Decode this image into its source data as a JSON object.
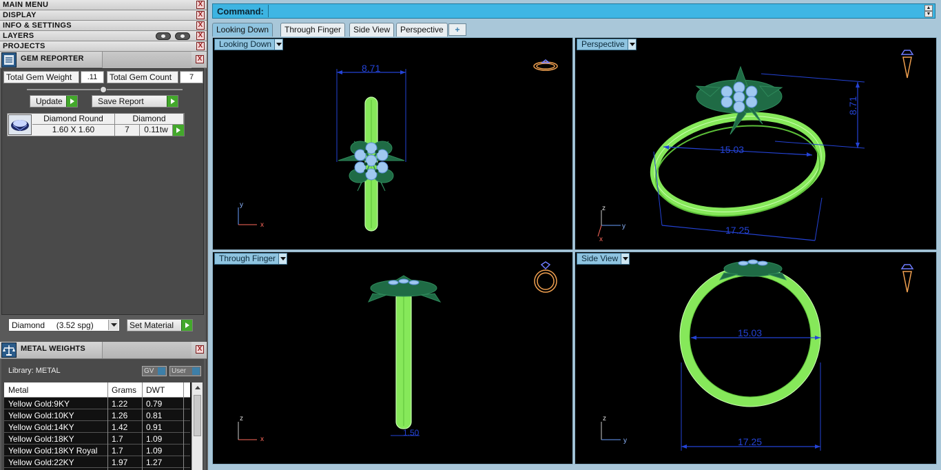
{
  "menu": {
    "items": [
      {
        "label": "MAIN MENU"
      },
      {
        "label": "DISPLAY"
      },
      {
        "label": "INFO & SETTINGS"
      },
      {
        "label": "LAYERS"
      },
      {
        "label": "PROJECTS"
      }
    ],
    "close_glyph": "X"
  },
  "gem_reporter": {
    "title": "GEM REPORTER",
    "total_weight_label": "Total Gem Weight",
    "total_weight_value": ".11",
    "total_count_label": "Total Gem Count",
    "total_count_value": "7",
    "update_label": "Update",
    "save_report_label": "Save Report",
    "gem": {
      "shape_header": "Diamond Round",
      "material_header": "Diamond",
      "size": "1.60 X 1.60",
      "count": "7",
      "weight": "0.11tw"
    },
    "material_select": "Diamond     (3.52 spg)",
    "set_material_label": "Set Material"
  },
  "metal_weights": {
    "title": "METAL WEIGHTS",
    "library_label": "Library: METAL",
    "gv_label": "GV",
    "user_label": "User",
    "columns": [
      "Metal",
      "Grams",
      "DWT"
    ],
    "rows": [
      [
        "Yellow Gold:9KY",
        "1.22",
        "0.79"
      ],
      [
        "Yellow Gold:10KY",
        "1.26",
        "0.81"
      ],
      [
        "Yellow Gold:14KY",
        "1.42",
        "0.91"
      ],
      [
        "Yellow Gold:18KY",
        "1.7",
        "1.09"
      ],
      [
        "Yellow Gold:18KY Royal",
        "1.7",
        "1.09"
      ],
      [
        "Yellow Gold:22KY",
        "1.97",
        "1.27"
      ]
    ]
  },
  "command": {
    "label": "Command:",
    "value": ""
  },
  "tabs": [
    {
      "label": "Looking Down",
      "active": true
    },
    {
      "label": "Through Finger",
      "active": false
    },
    {
      "label": "Side View",
      "active": false
    },
    {
      "label": "Perspective",
      "active": false
    }
  ],
  "viewports": {
    "top_left": {
      "label": "Looking Down",
      "dims": [
        "8.71"
      ],
      "axes": [
        "y",
        "x"
      ]
    },
    "top_right": {
      "label": "Perspective",
      "dims": [
        "15.03",
        "8.71",
        "17.25"
      ],
      "axes": [
        "z",
        "y",
        "x"
      ]
    },
    "bottom_left": {
      "label": "Through Finger",
      "dims": [
        "1.50"
      ],
      "axes": [
        "z",
        "x"
      ]
    },
    "bottom_right": {
      "label": "Side View",
      "dims": [
        "15.03",
        "17.25"
      ],
      "axes": [
        "z",
        "y"
      ]
    }
  },
  "colors": {
    "ring_green": "#8ef060",
    "leaf_green": "#1f6b45",
    "gem_blue": "#9fc8f0",
    "dimension_blue": "#2443d6",
    "icon_orange": "#f0a050",
    "cmd_blue": "#3db4e2"
  }
}
